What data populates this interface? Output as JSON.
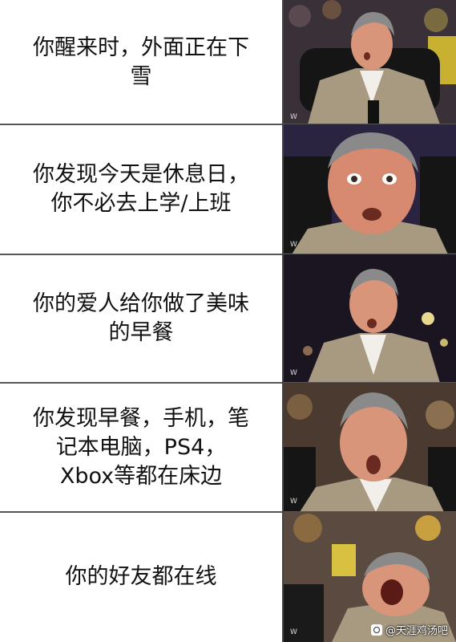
{
  "panels": [
    {
      "line1": "你醒来时，外面正在下",
      "line2": "雪"
    },
    {
      "line1": "你发现今天是休息日，",
      "line2": "你不必去上学/上班"
    },
    {
      "line1": "你的爱人给你做了美味",
      "line2": "的早餐"
    },
    {
      "line1": "你发现早餐，手机，笔",
      "line2": "记本电脑，PS4，",
      "line3": "Xbox等都在床边"
    },
    {
      "line1": "你的好友都在线"
    }
  ],
  "watermark": {
    "text": "@天涯鸡汤吧",
    "icon": "weibo-icon"
  },
  "colors": {
    "suit": "#a89a80",
    "shirt": "#f2eeea",
    "skin": "#d9957a",
    "hair": "#8a8a8a",
    "crowd": "#2a2230",
    "chair": "#151515"
  }
}
